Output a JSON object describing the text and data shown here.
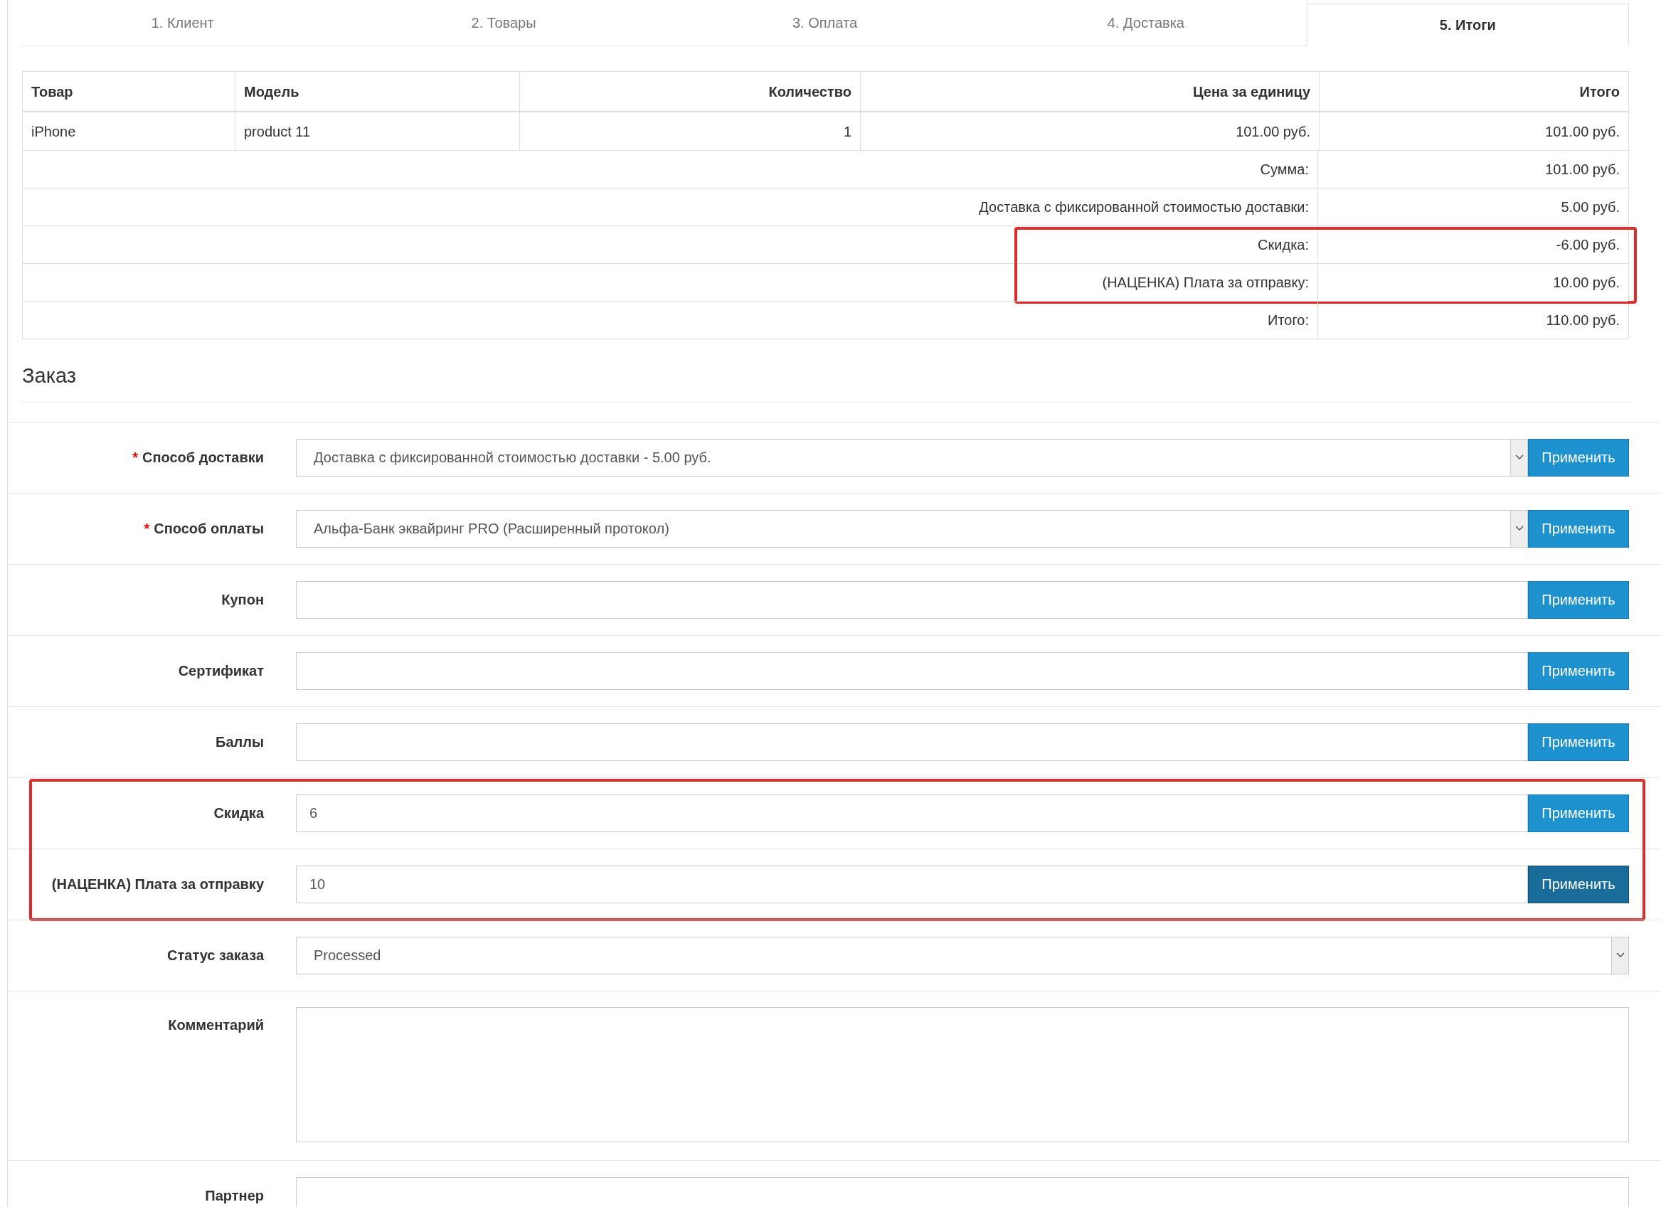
{
  "tabs": [
    {
      "label": "1. Клиент",
      "selected": false
    },
    {
      "label": "2. Товары",
      "selected": false
    },
    {
      "label": "3. Оплата",
      "selected": false
    },
    {
      "label": "4. Доставка",
      "selected": false
    },
    {
      "label": "5. Итоги",
      "selected": true
    }
  ],
  "table": {
    "columns": [
      "Товар",
      "Модель",
      "Количество",
      "Цена за единицу",
      "Итого"
    ],
    "rows": [
      [
        "iPhone",
        "product 11",
        "1",
        "101.00 руб.",
        "101.00 руб."
      ]
    ],
    "total_groups": [
      {
        "highlighted": false,
        "rows": [
          {
            "label": "Сумма:",
            "value": "101.00 руб."
          },
          {
            "label": "Доставка с фиксированной стоимостью доставки:",
            "value": "5.00 руб."
          }
        ]
      },
      {
        "highlighted": true,
        "rows": [
          {
            "label": "Скидка:",
            "value": "-6.00 руб."
          },
          {
            "label": "(НАЦЕНКА) Плата за отправку:",
            "value": "10.00 руб."
          }
        ]
      },
      {
        "highlighted": false,
        "rows": [
          {
            "label": "Итого:",
            "value": "110.00 руб."
          }
        ]
      }
    ]
  },
  "order": {
    "title": "Заказ",
    "field_groups": [
      {
        "highlighted": false,
        "fields": [
          {
            "label": "Способ доставки",
            "required_mark": "*",
            "kind": "select",
            "value": "Доставка с фиксированной стоимостью доставки - 5.00 руб.",
            "button": "Применить",
            "pressed": false
          },
          {
            "label": "Способ оплаты",
            "required_mark": "*",
            "kind": "select",
            "value": "Альфа-Банк эквайринг PRO (Расширенный протокол)",
            "button": "Применить",
            "pressed": false
          },
          {
            "label": "Купон",
            "kind": "input",
            "button": "Применить",
            "pressed": false
          },
          {
            "label": "Сертификат",
            "kind": "input",
            "button": "Применить",
            "pressed": false
          },
          {
            "label": "Баллы",
            "kind": "input",
            "button": "Применить",
            "pressed": false
          }
        ]
      },
      {
        "highlighted": true,
        "fields": [
          {
            "label": "Скидка",
            "kind": "input",
            "value": "6",
            "button": "Применить",
            "pressed": false
          },
          {
            "label": "(НАЦЕНКА) Плата за отправку",
            "kind": "input",
            "value": "10",
            "button": "Применить",
            "pressed": true
          }
        ]
      },
      {
        "highlighted": false,
        "fields": [
          {
            "label": "Статус заказа",
            "kind": "select",
            "value": "Processed"
          },
          {
            "label": "Комментарий",
            "kind": "textarea"
          },
          {
            "label": "Партнер",
            "kind": "input"
          }
        ]
      }
    ]
  }
}
